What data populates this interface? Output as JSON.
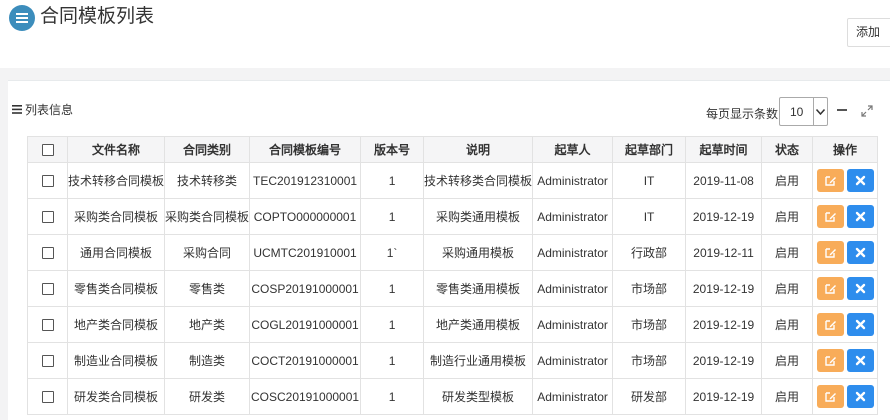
{
  "header": {
    "title": "合同模板列表",
    "add_label": "添加"
  },
  "panel": {
    "title": "列表信息",
    "page_size_label": "每页显示条数:",
    "page_size_value": "10"
  },
  "table": {
    "columns": [
      "",
      "文件名称",
      "合同类别",
      "合同模板编号",
      "版本号",
      "说明",
      "起草人",
      "起草部门",
      "起草时间",
      "状态",
      "操作"
    ],
    "rows": [
      [
        "技术转移合同模板",
        "技术转移类",
        "TEC201912310001",
        "1",
        "技术转移类合同模板",
        "Administrator",
        "IT",
        "2019-11-08",
        "启用"
      ],
      [
        "采购类合同模板",
        "采购类合同模板",
        "COPTO000000001",
        "1",
        "采购类通用模板",
        "Administrator",
        "IT",
        "2019-12-19",
        "启用"
      ],
      [
        "通用合同模板",
        "采购合同",
        "UCMTC201910001",
        "1`",
        "采购通用模板",
        "Administrator",
        "行政部",
        "2019-12-11",
        "启用"
      ],
      [
        "零售类合同模板",
        "零售类",
        "COSP20191000001",
        "1",
        "零售类通用模板",
        "Administrator",
        "市场部",
        "2019-12-19",
        "启用"
      ],
      [
        "地产类合同模板",
        "地产类",
        "COGL20191000001",
        "1",
        "地产类通用模板",
        "Administrator",
        "市场部",
        "2019-12-19",
        "启用"
      ],
      [
        "制造业合同模板",
        "制造类",
        "COCT20191000001",
        "1",
        "制造行业通用模板",
        "Administrator",
        "市场部",
        "2019-12-19",
        "启用"
      ],
      [
        "研发类合同模板",
        "研发类",
        "COSC20191000001",
        "1",
        "研发类型模板",
        "Administrator",
        "研发部",
        "2019-12-19",
        "启用"
      ]
    ]
  },
  "icons": {
    "title": "menu-icon",
    "edit": "edit-icon",
    "delete": "close-icon",
    "minimize": "minimize-icon",
    "expand": "expand-icon"
  },
  "colors": {
    "edit_button": "#f8ac59",
    "delete_button": "#2e8ded",
    "title_icon": "#3c8dbc"
  }
}
